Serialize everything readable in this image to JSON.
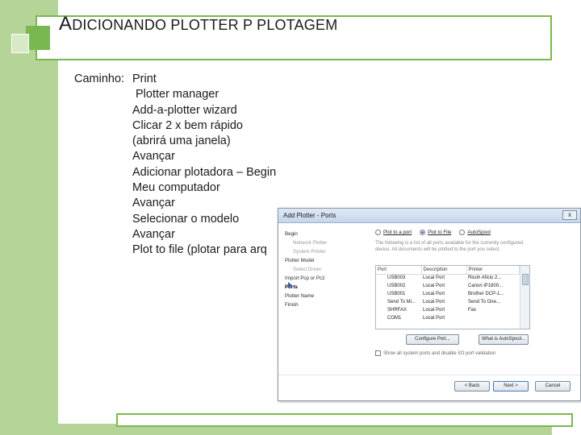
{
  "slide": {
    "title_cap": "A",
    "title_rest": "DICIONANDO PLOTTER P PLOTAGEM",
    "path_label": "Caminho:",
    "steps": [
      "Print",
      "Plotter manager",
      "Add-a-plotter wizard",
      "Clicar 2 x bem rápido",
      "(abrirá uma janela)",
      "Avançar",
      "Adicionar plotadora – Begin",
      "Meu computador",
      "Avançar",
      "Selecionar o modelo",
      "Avançar",
      "Plot to file (plotar para arq"
    ],
    "colors": {
      "accent": "#79b850",
      "accent_light": "#b5d598"
    }
  },
  "dialog": {
    "title": "Add Plotter - Ports",
    "close_label": "x",
    "nav": [
      {
        "label": "Begin",
        "sub": false,
        "current": false
      },
      {
        "label": "Network Plotter",
        "sub": true,
        "current": false
      },
      {
        "label": "System Printer",
        "sub": true,
        "current": false
      },
      {
        "label": "Plotter Model",
        "sub": false,
        "current": false
      },
      {
        "label": "Select Driver",
        "sub": true,
        "current": false
      },
      {
        "label": "Import Pcp or Pc2",
        "sub": false,
        "current": false
      },
      {
        "label": "Ports",
        "sub": false,
        "current": true
      },
      {
        "label": "Plotter Name",
        "sub": false,
        "current": false
      },
      {
        "label": "Finish",
        "sub": false,
        "current": false
      }
    ],
    "radios": [
      {
        "label": "Plot to a port",
        "selected": false
      },
      {
        "label": "Plot to File",
        "selected": true
      },
      {
        "label": "AutoSpool",
        "selected": false
      }
    ],
    "description": "The following is a list of all ports available for the currently configured device. All documents will be plotted to the port you select.",
    "ports_table": {
      "columns": [
        "Port",
        "Description",
        "Printer"
      ],
      "rows": [
        [
          "USB003",
          "Local Port",
          "Ricoh Aficio 2..."
        ],
        [
          "USB002",
          "Local Port",
          "Canon iP1800..."
        ],
        [
          "USB001",
          "Local Port",
          "Brother DCP-1..."
        ],
        [
          "Send To Mi...",
          "Local Port",
          "Send To One..."
        ],
        [
          "SHRFAX",
          "Local Port",
          "Fax"
        ],
        [
          "COM1",
          "Local Port",
          ""
        ]
      ]
    },
    "configure_port_label": "Configure Port...",
    "what_is_autospool_label": "What is AutoSpool...",
    "show_all_ports_label": "Show all system ports and disable I/O port validation",
    "back_label": "< Back",
    "next_label": "Next >",
    "cancel_label": "Cancel"
  }
}
